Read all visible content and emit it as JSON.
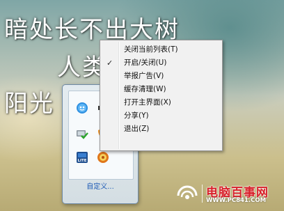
{
  "wallpaper": {
    "lines": [
      "暗处长不出大树",
      "人类",
      "阳光"
    ]
  },
  "tray": {
    "icons": [
      "qq-penguin-icon",
      "speaker-icon",
      "network-check-icon",
      "shield-icon",
      "lite-app-icon",
      "orange-app-icon"
    ],
    "customize_label": "自定义..."
  },
  "context_menu": {
    "items": [
      {
        "label": "关闭当前列表(T)",
        "checked": false
      },
      {
        "label": "开启/关闭(U)",
        "checked": true
      },
      {
        "label": "举报广告(V)",
        "checked": false
      },
      {
        "label": "缓存清理(W)",
        "checked": false
      },
      {
        "label": "打开主界面(X)",
        "checked": false
      },
      {
        "label": "分享(Y)",
        "checked": false
      },
      {
        "label": "退出(Z)",
        "checked": false
      }
    ],
    "check_symbol": "✓"
  },
  "watermark": {
    "title": "电脑百事网",
    "url": "WWW.PC841.COM"
  },
  "colors": {
    "watermark_red": "#d8202a",
    "link_blue": "#1d5ab5",
    "menu_bg": "#f1f1f1"
  }
}
